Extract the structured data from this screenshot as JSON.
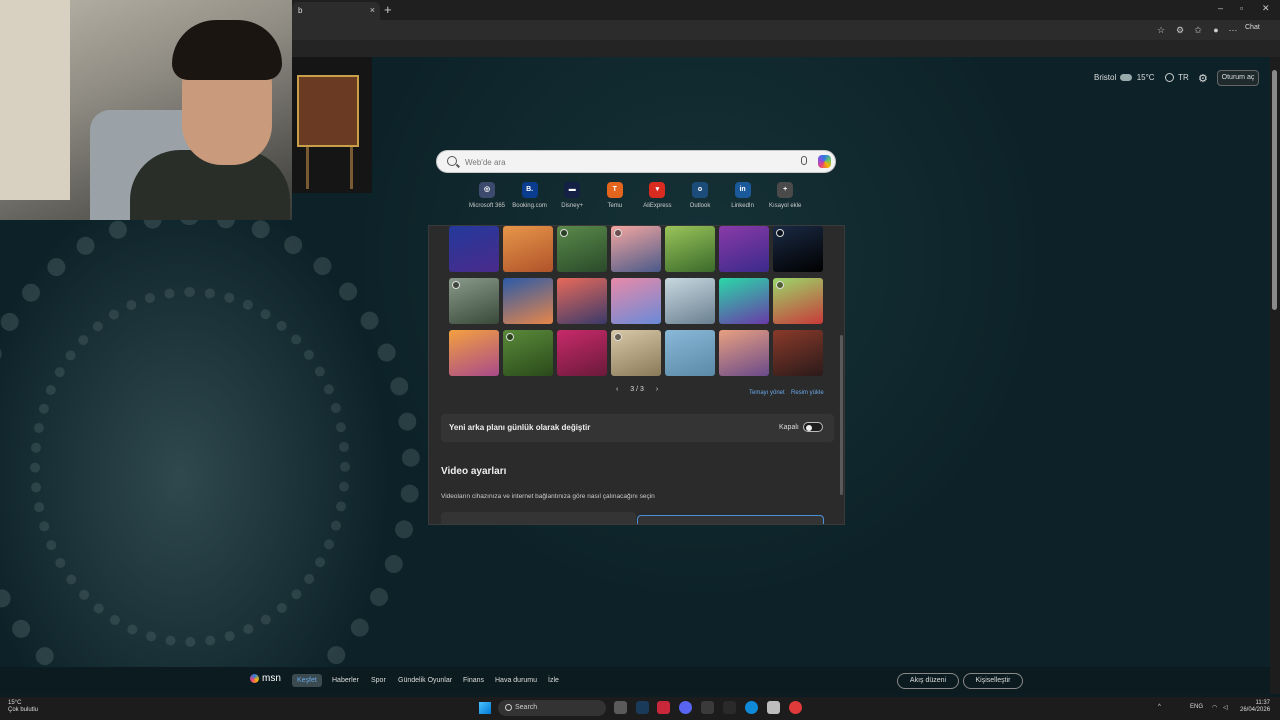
{
  "browser": {
    "tab_close": "×",
    "new_tab": "+",
    "tab_partial_title": "b",
    "window_controls": [
      "–",
      "▫",
      "✕"
    ],
    "copilot_label": "Chat"
  },
  "search": {
    "placeholder": "Web'de ara"
  },
  "shortcuts": [
    {
      "label": "Microsoft 365",
      "color": "#3c4a6e",
      "glyph": "◎"
    },
    {
      "label": "Booking.com",
      "color": "#0a3d8f",
      "glyph": "B."
    },
    {
      "label": "Disney+",
      "color": "#152045",
      "glyph": "▬"
    },
    {
      "label": "Temu",
      "color": "#e4651d",
      "glyph": "T"
    },
    {
      "label": "AliExpress",
      "color": "#d92b1f",
      "glyph": "▾"
    },
    {
      "label": "Outlook",
      "color": "#1c4d7a",
      "glyph": "o"
    },
    {
      "label": "LinkedIn",
      "color": "#1b5a9a",
      "glyph": "in"
    },
    {
      "label": "Kısayol ekle",
      "color": "#4a4a4a",
      "glyph": "+"
    }
  ],
  "weather": {
    "city": "Bristol",
    "temp": "15°C"
  },
  "language": "TR",
  "signin_label": "Oturum aç",
  "backgrounds": {
    "thumbnails": [
      {
        "colors": [
          "#233a9c",
          "#4a2a8a"
        ],
        "video": false
      },
      {
        "colors": [
          "#e7964a",
          "#b0532a"
        ],
        "video": false
      },
      {
        "colors": [
          "#5a8a4a",
          "#2a4a2a"
        ],
        "video": true
      },
      {
        "colors": [
          "#f4a6a0",
          "#4a5a8a"
        ],
        "video": true
      },
      {
        "colors": [
          "#9ac45a",
          "#3a6a2a"
        ],
        "video": false
      },
      {
        "colors": [
          "#8a3aa8",
          "#3a2a8a"
        ],
        "video": false
      },
      {
        "colors": [
          "#1a2a44",
          "#000000"
        ],
        "video": true
      },
      {
        "colors": [
          "#8a9a8a",
          "#3a4a3a"
        ],
        "video": true
      },
      {
        "colors": [
          "#2a5aa8",
          "#e8864a"
        ],
        "video": false
      },
      {
        "colors": [
          "#e86a5a",
          "#3a3a6a"
        ],
        "video": false
      },
      {
        "colors": [
          "#e88aa8",
          "#6a8ad8"
        ],
        "video": false
      },
      {
        "colors": [
          "#c8d8e0",
          "#6a8090"
        ],
        "video": false
      },
      {
        "colors": [
          "#2ad8a8",
          "#6a3aa8"
        ],
        "video": false
      },
      {
        "colors": [
          "#9ad86a",
          "#c83a3a"
        ],
        "video": true
      },
      {
        "colors": [
          "#f4a040",
          "#a84a8a"
        ],
        "video": false
      },
      {
        "colors": [
          "#5a8a3a",
          "#2a4a1a"
        ],
        "video": true
      },
      {
        "colors": [
          "#c82a6a",
          "#6a1a3a"
        ],
        "video": false
      },
      {
        "colors": [
          "#d8c8a8",
          "#8a7a5a"
        ],
        "video": true
      },
      {
        "colors": [
          "#8ab8d8",
          "#5a8aa8"
        ],
        "video": false
      },
      {
        "colors": [
          "#e8a080",
          "#6a4a8a"
        ],
        "video": false
      },
      {
        "colors": [
          "#8a3a2a",
          "#2a1a1a"
        ],
        "video": false
      }
    ],
    "pager_text": "3 / 3",
    "prev": "‹",
    "next": "›",
    "manage_label": "Temayı yönet",
    "upload_label": "Resim yükle"
  },
  "daily": {
    "label": "Yeni arka planı günlük olarak değiştir",
    "toggle_label": "Kapalı",
    "enabled": false
  },
  "video": {
    "title": "Video ayarları",
    "description": "Videoların cihazınıza ve internet bağlantınıza göre nasıl çalınacağını seçin"
  },
  "msn": {
    "logo": "msn",
    "nav": [
      "Keşfet",
      "Haberler",
      "Spor",
      "Gündelik Oyunlar",
      "Finans",
      "Hava durumu",
      "İzle"
    ],
    "layout_label": "Akış düzeni",
    "customize_label": "Kişiselleştir"
  },
  "taskbar": {
    "weather_temp": "15°C",
    "weather_desc": "Çok bulutlu",
    "search_label": "Search",
    "lang": "ENG",
    "time": "11:37",
    "date": "26/04/2026"
  }
}
